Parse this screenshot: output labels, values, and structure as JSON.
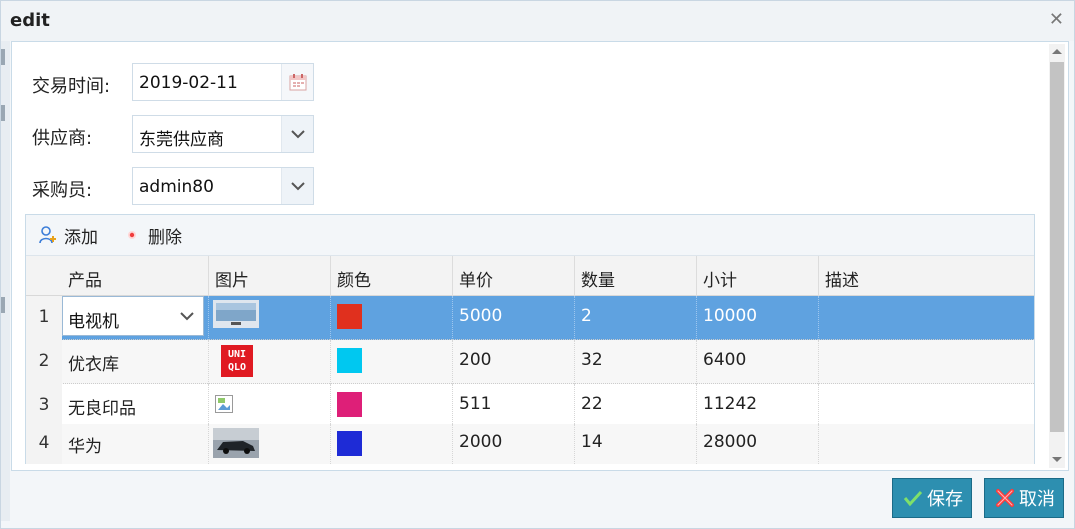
{
  "window": {
    "title": "edit"
  },
  "form": {
    "date_label": "交易时间:",
    "date_value": "2019-02-11",
    "supplier_label": "供应商:",
    "supplier_value": "东莞供应商",
    "buyer_label": "采购员:",
    "buyer_value": "admin80"
  },
  "toolbar": {
    "add_label": "添加",
    "delete_label": "删除"
  },
  "table": {
    "columns": [
      "产品",
      "图片",
      "颜色",
      "单价",
      "数量",
      "小计",
      "描述"
    ],
    "rows": [
      {
        "num": "1",
        "product": "电视机",
        "image": "tv",
        "color": "#e0301e",
        "price": "5000",
        "qty": "2",
        "subtotal": "10000",
        "desc": ""
      },
      {
        "num": "2",
        "product": "优衣库",
        "image": "uniqlo-logo",
        "color": "#00c8f0",
        "price": "200",
        "qty": "32",
        "subtotal": "6400",
        "desc": ""
      },
      {
        "num": "3",
        "product": "无良印品",
        "image": "broken-image",
        "color": "#de1f78",
        "price": "511",
        "qty": "22",
        "subtotal": "11242",
        "desc": ""
      },
      {
        "num": "4",
        "product": "华为",
        "image": "car",
        "color": "#1e2bd6",
        "price": "2000",
        "qty": "14",
        "subtotal": "28000",
        "desc": ""
      }
    ]
  },
  "logo_text": {
    "line1": "UNI",
    "line2": "QLO"
  },
  "footer": {
    "save_label": "保存",
    "cancel_label": "取消"
  }
}
